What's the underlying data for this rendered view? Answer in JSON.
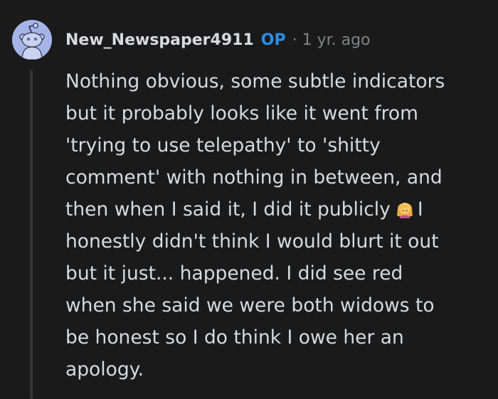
{
  "comment": {
    "author": "New_Newspaper4911",
    "badge": "OP",
    "separator": "·",
    "age": "1 yr. ago",
    "avatar_icon": "reddit-snoo-avatar-icon",
    "emoji_icon": "woman-facepalming-emoji-icon",
    "colors": {
      "background": "#1a1a1b",
      "text": "#d7dadc",
      "meta": "#818384",
      "op_badge": "#2a8fe8",
      "avatar_bg": "#a5b4e6",
      "thread_line": "#343536"
    },
    "body_lines": [
      "Nothing obvious, some subtle indicators",
      "but it probably looks like it went from",
      "'trying to use telepathy' to 'shitty",
      "comment' with nothing in between, and",
      "then when I said it, I did it publicly",
      "I",
      "honestly didn't think I would blurt it out",
      "but it just... happened. I did see red",
      "when she said we were both widows to",
      "be honest so I do think I owe her an",
      "apology."
    ]
  }
}
